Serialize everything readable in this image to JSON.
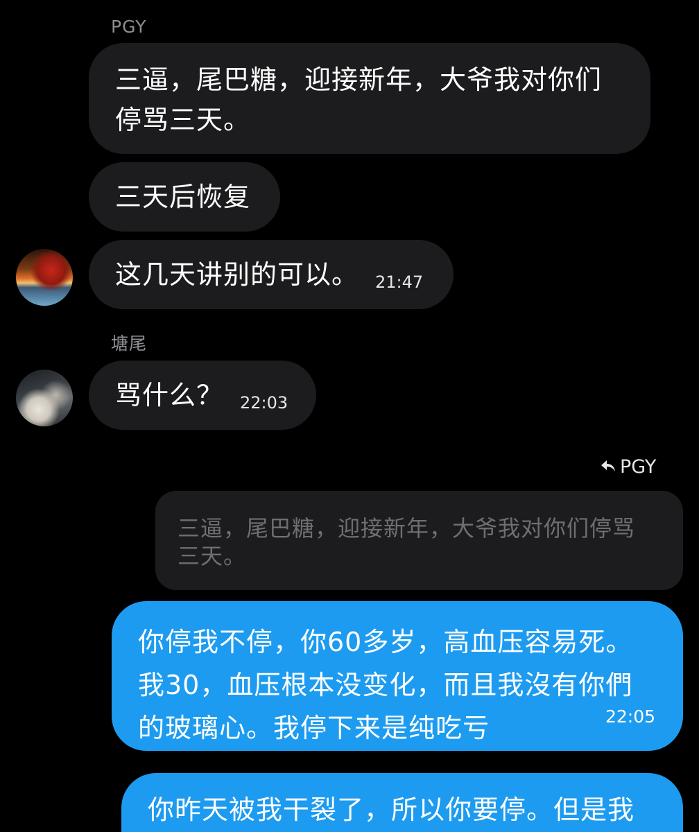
{
  "messages": {
    "group1": {
      "sender": "PGY",
      "bubble1": "三逼，尾巴糖，迎接新年，大爷我对你们停骂三天。",
      "bubble2": "三天后恢复",
      "bubble3": "这几天讲别的可以。",
      "bubble3_time": "21:47",
      "avatar": "sunset-lake-avatar"
    },
    "group2": {
      "sender": "塘尾",
      "bubble1": "骂什么？",
      "bubble1_time": "22:03",
      "avatar": "car-interior-avatar"
    },
    "outgoing": {
      "reply_to_label": "PGY",
      "reply_icon": "reply-arrow-icon",
      "quoted_text": "三逼，尾巴糖，迎接新年，大爷我对你们停骂三天。",
      "bubble1": "你停我不停，你60多岁，高血压容易死。我30，血压根本没变化，而且我沒有你們的玻璃心。我停下来是纯吃亏",
      "bubble1_time": "22:05",
      "bubble2": "你昨天被我干裂了，所以你要停。但是我"
    }
  },
  "colors": {
    "background": "#000000",
    "incoming_bubble": "#1c1c1e",
    "outgoing_bubble": "#1d9bf0",
    "sender_name": "#8e8e93",
    "quoted_text": "#6e6e73"
  }
}
